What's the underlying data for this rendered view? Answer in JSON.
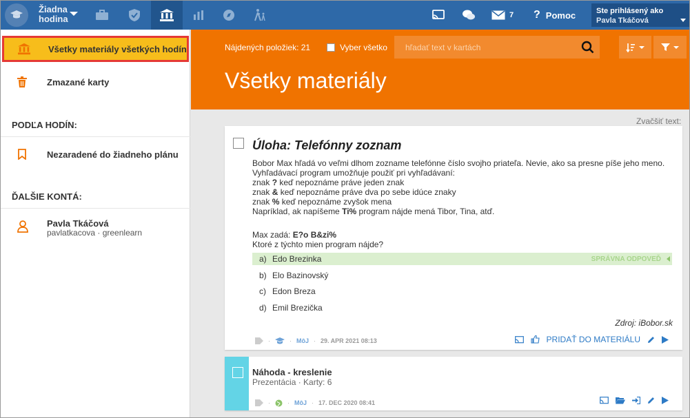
{
  "topbar": {
    "hodina": [
      "Žiadna",
      "hodina"
    ],
    "messages_count": "7",
    "help_label": "Pomoc",
    "signed_in_label": "Ste prihlásený ako",
    "user_name": "Pavla Tkáčová",
    "colors": {
      "bar": "#2e69a8",
      "active": "#21558d"
    }
  },
  "sidebar": {
    "all_materials": "Všetky materiály všetkých hodín",
    "deleted_cards": "Zmazané karty",
    "by_lessons_head": "PODĽA HODÍN:",
    "unassigned": "Nezaradené do žiadneho plánu",
    "other_accounts_head": "ĎALŠIE KONTÁ:",
    "account_name": "Pavla Tkáčová",
    "account_sub": "pavlatkacova · greenlearn"
  },
  "header": {
    "found_label": "Nájdených položiek: 21",
    "select_all": "Vyber všetko",
    "search_placeholder": "hľadať text v kartách",
    "title": "Všetky materiály",
    "color": "#f07300"
  },
  "zoom_text": "Zvačšiť text:",
  "card1": {
    "title": "Úloha: Telefónny zoznam",
    "body": [
      "Bobor Max hľadá vo veľmi dlhom zozname telefónne číslo svojho priateľa. Nevie, ako sa presne píše jeho meno.",
      "Vyhľadávací program umožňuje použiť pri vyhľadávaní:",
      "znak ? keď nepoznáme práve jeden znak",
      "znak & keď nepoznáme práve dva po sebe idúce znaky",
      "znak % keď nepoznáme zvyšok mena",
      "Napríklad, ak napíšeme Ti% program nájde mená Tibor, Tina, atď."
    ],
    "query_prefix": "Max zadá: ",
    "query_bold": "E?o B&zi%",
    "question": "Ktoré z týchto mien program nájde?",
    "answers": [
      {
        "letter": "a)",
        "text": "Edo Brezinka"
      },
      {
        "letter": "b)",
        "text": "Elo Bazinovský"
      },
      {
        "letter": "c)",
        "text": "Edon Breza"
      },
      {
        "letter": "d)",
        "text": "Emil Brezička"
      }
    ],
    "correct_label": "SPRÁVNA ODPOVEĎ",
    "source": "Zdroj: iBobor.sk",
    "owner": "MôJ",
    "date": "29. APR 2021 08:13",
    "add_to_material": "PRIDAŤ DO MATERIÁLU"
  },
  "card2": {
    "title": "Náhoda - kreslenie",
    "subtitle": "Prezentácia · Karty: 6",
    "owner": "MôJ",
    "date": "17. DEC 2020 08:41",
    "accent": "#63d4e6"
  }
}
